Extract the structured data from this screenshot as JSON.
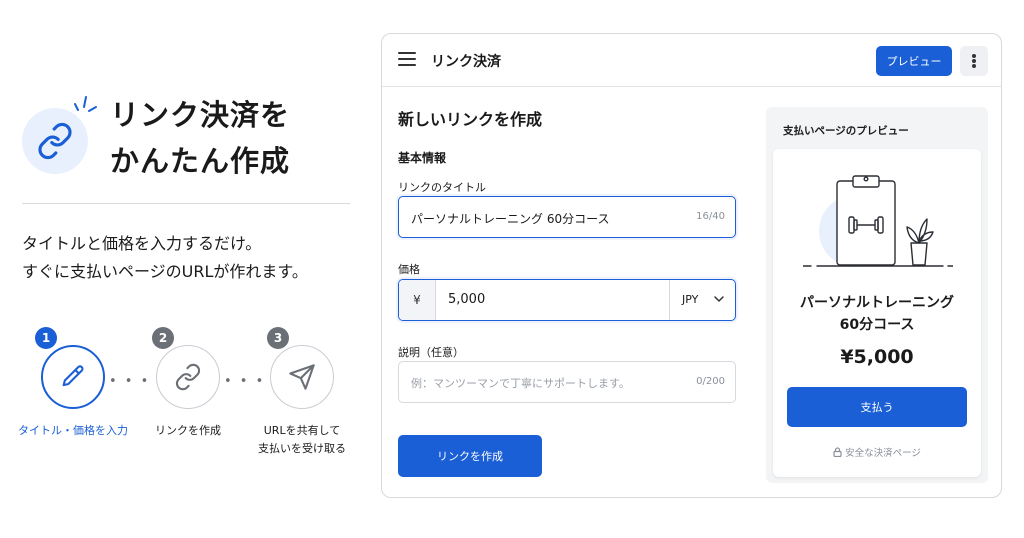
{
  "promo": {
    "headline_line1": "リンク決済を",
    "headline_line2": "かんたん作成",
    "lead_line1": "タイトルと価格を入力するだけ。",
    "lead_line2": "すぐに支払いページのURLが作れます。",
    "steps": [
      {
        "number": "1",
        "label_line1": "タイトル・価格を入力",
        "label_line2": "",
        "icon": "pencil-icon",
        "active": true
      },
      {
        "number": "2",
        "label_line1": "リンクを作成",
        "label_line2": "",
        "icon": "link-icon",
        "active": false
      },
      {
        "number": "3",
        "label_line1": "URLを共有して",
        "label_line2": "支払いを受け取る",
        "icon": "send-icon",
        "active": false
      }
    ],
    "dots": "• • • • •"
  },
  "app": {
    "title": "リンク決済",
    "preview_button": "プレビュー",
    "form": {
      "heading": "新しいリンクを作成",
      "section": "基本情報",
      "title_label": "リンクのタイトル",
      "title_value": "パーソナルトレーニング 60分コース",
      "title_count": "16/40",
      "price_label": "価格",
      "currency_symbol": "¥",
      "price_value": "5,000",
      "currency": "JPY",
      "desc_label": "説明（任意）",
      "desc_placeholder": "例：マンツーマンで丁寧にサポートします。",
      "desc_count": "0/200",
      "create_button": "リンクを作成"
    },
    "preview": {
      "heading": "支払いページのプレビュー",
      "product_line1": "パーソナルトレーニング",
      "product_line2": "60分コース",
      "price": "¥5,000",
      "pay_button": "支払う",
      "secure_note": "安全な決済ページ"
    }
  },
  "colors": {
    "accent": "#1a5fd6",
    "accent_light": "#e9f0fd",
    "muted": "#6b6f76"
  }
}
